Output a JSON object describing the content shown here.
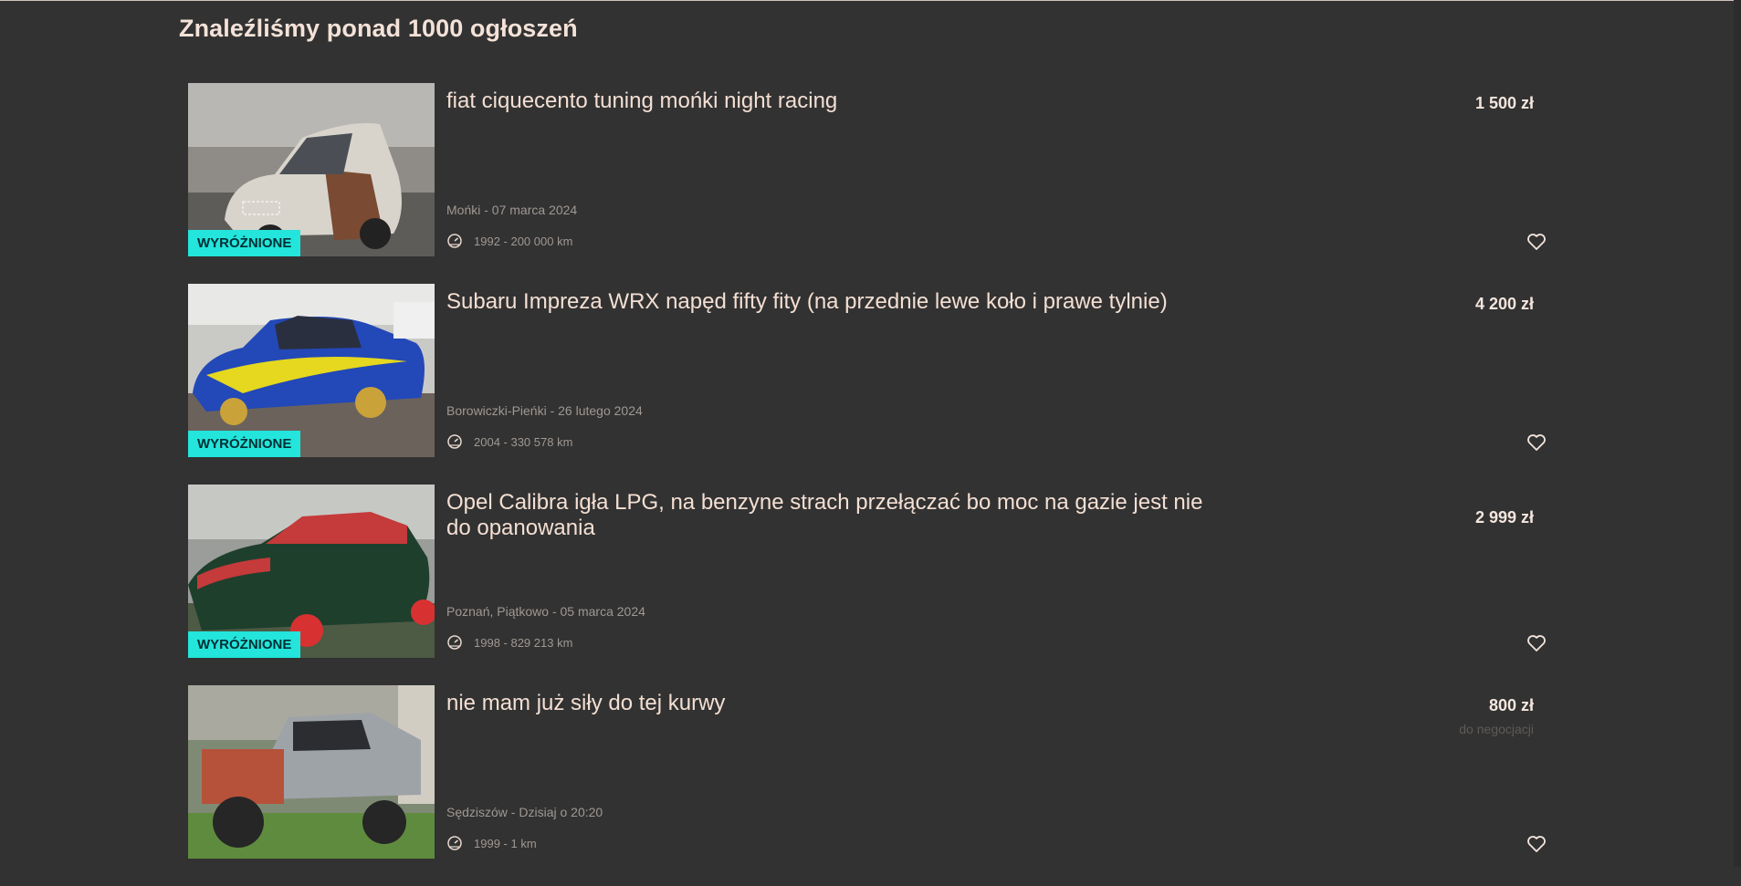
{
  "heading": "Znaleźliśmy ponad 1000 ogłoszeń",
  "badge_label": "WYRÓŻNIONE",
  "colors": {
    "background": "#323232",
    "badge": "#23e5db",
    "text": "#f4dfd3",
    "muted": "#a09893"
  },
  "listings": [
    {
      "title": "fiat ciquecento tuning mońki night racing",
      "price": "1 500 zł",
      "negotiable": "",
      "location_date": "Mońki - 07 marca 2024",
      "year_mileage": "1992 - 200 000 km",
      "featured": true,
      "icons": [
        "odometer-icon",
        "heart-icon"
      ]
    },
    {
      "title": "Subaru Impreza WRX napęd fifty fity (na przednie lewe koło i prawe tylnie)",
      "price": "4 200 zł",
      "negotiable": "",
      "location_date": "Borowiczki-Pieńki - 26 lutego 2024",
      "year_mileage": "2004 - 330 578 km",
      "featured": true,
      "icons": [
        "odometer-icon",
        "heart-icon"
      ]
    },
    {
      "title": "Opel Calibra igła LPG, na benzyne strach przełączać bo moc na gazie jest nie do opanowania",
      "price": "2 999 zł",
      "negotiable": "",
      "location_date": "Poznań, Piątkowo - 05 marca 2024",
      "year_mileage": "1998 - 829 213 km",
      "featured": true,
      "icons": [
        "odometer-icon",
        "heart-icon"
      ]
    },
    {
      "title": "nie mam już siły do tej kurwy",
      "price": "800 zł",
      "negotiable": "do negocjacji",
      "location_date": "Sędziszów - Dzisiaj o 20:20",
      "year_mileage": "1999 - 1 km",
      "featured": false,
      "icons": [
        "odometer-icon",
        "heart-icon"
      ]
    }
  ]
}
